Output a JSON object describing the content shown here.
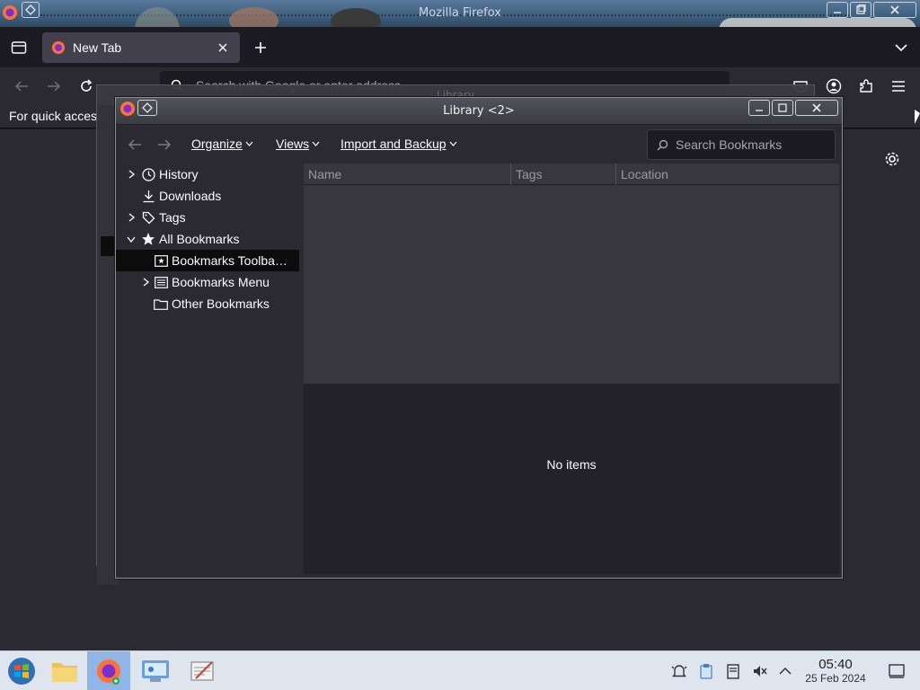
{
  "firefox": {
    "window_title": "Mozilla Firefox",
    "tab": {
      "label": "New Tab"
    },
    "urlbar": {
      "placeholder": "Search with Google or enter address"
    },
    "bookmarks_hint": "For quick acces"
  },
  "library_back": {
    "title": "Library"
  },
  "library": {
    "title": "Library <2>",
    "menus": {
      "organize": "Organize",
      "views": "Views",
      "import_backup": "Import and Backup"
    },
    "search": {
      "placeholder": "Search Bookmarks"
    },
    "tree": [
      {
        "label": "History",
        "icon": "clock-icon"
      },
      {
        "label": "Downloads",
        "icon": "download-icon"
      },
      {
        "label": "Tags",
        "icon": "tag-icon"
      },
      {
        "label": "All Bookmarks",
        "icon": "star-icon"
      },
      {
        "label": "Bookmarks Toolba…",
        "icon": "bookmark-toolbar-icon",
        "selected": true
      },
      {
        "label": "Bookmarks Menu",
        "icon": "bookmark-menu-icon"
      },
      {
        "label": "Other Bookmarks",
        "icon": "folder-icon"
      }
    ],
    "columns": [
      "Name",
      "Tags",
      "Location"
    ],
    "details_text": "No items"
  },
  "taskbar": {
    "time": "05:40",
    "date": "25 Feb 2024",
    "apps": [
      "start-menu-icon",
      "file-manager-icon",
      "firefox-icon",
      "control-panel-icon",
      "text-editor-icon"
    ]
  }
}
